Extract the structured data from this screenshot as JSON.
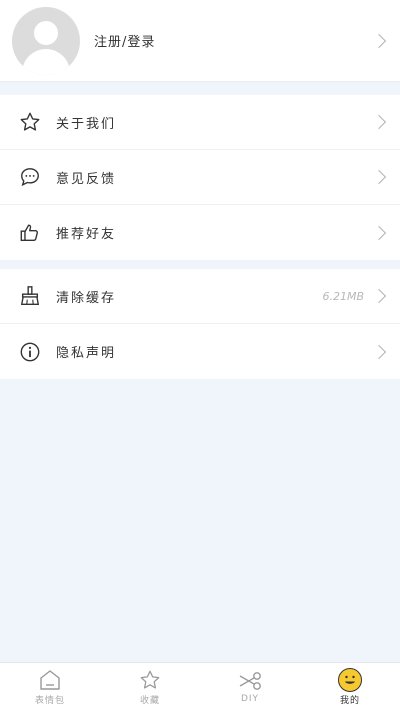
{
  "profile": {
    "label": "注册/登录"
  },
  "menu_group_1": [
    {
      "label": "关于我们",
      "icon": "star-icon"
    },
    {
      "label": "意见反馈",
      "icon": "chat-bubble-icon"
    },
    {
      "label": "推荐好友",
      "icon": "thumbs-up-icon"
    }
  ],
  "menu_group_2": [
    {
      "label": "清除缓存",
      "icon": "broom-icon",
      "value": "6.21MB"
    },
    {
      "label": "隐私声明",
      "icon": "info-icon"
    }
  ],
  "tabs": [
    {
      "label": "表情包",
      "icon": "home-icon"
    },
    {
      "label": "收藏",
      "icon": "star-icon"
    },
    {
      "label": "DIY",
      "icon": "scissors-icon"
    },
    {
      "label": "我的",
      "icon": "smiley-icon",
      "active": true
    }
  ],
  "colors": {
    "accent": "#f7c930",
    "background": "#f0f4fb"
  }
}
